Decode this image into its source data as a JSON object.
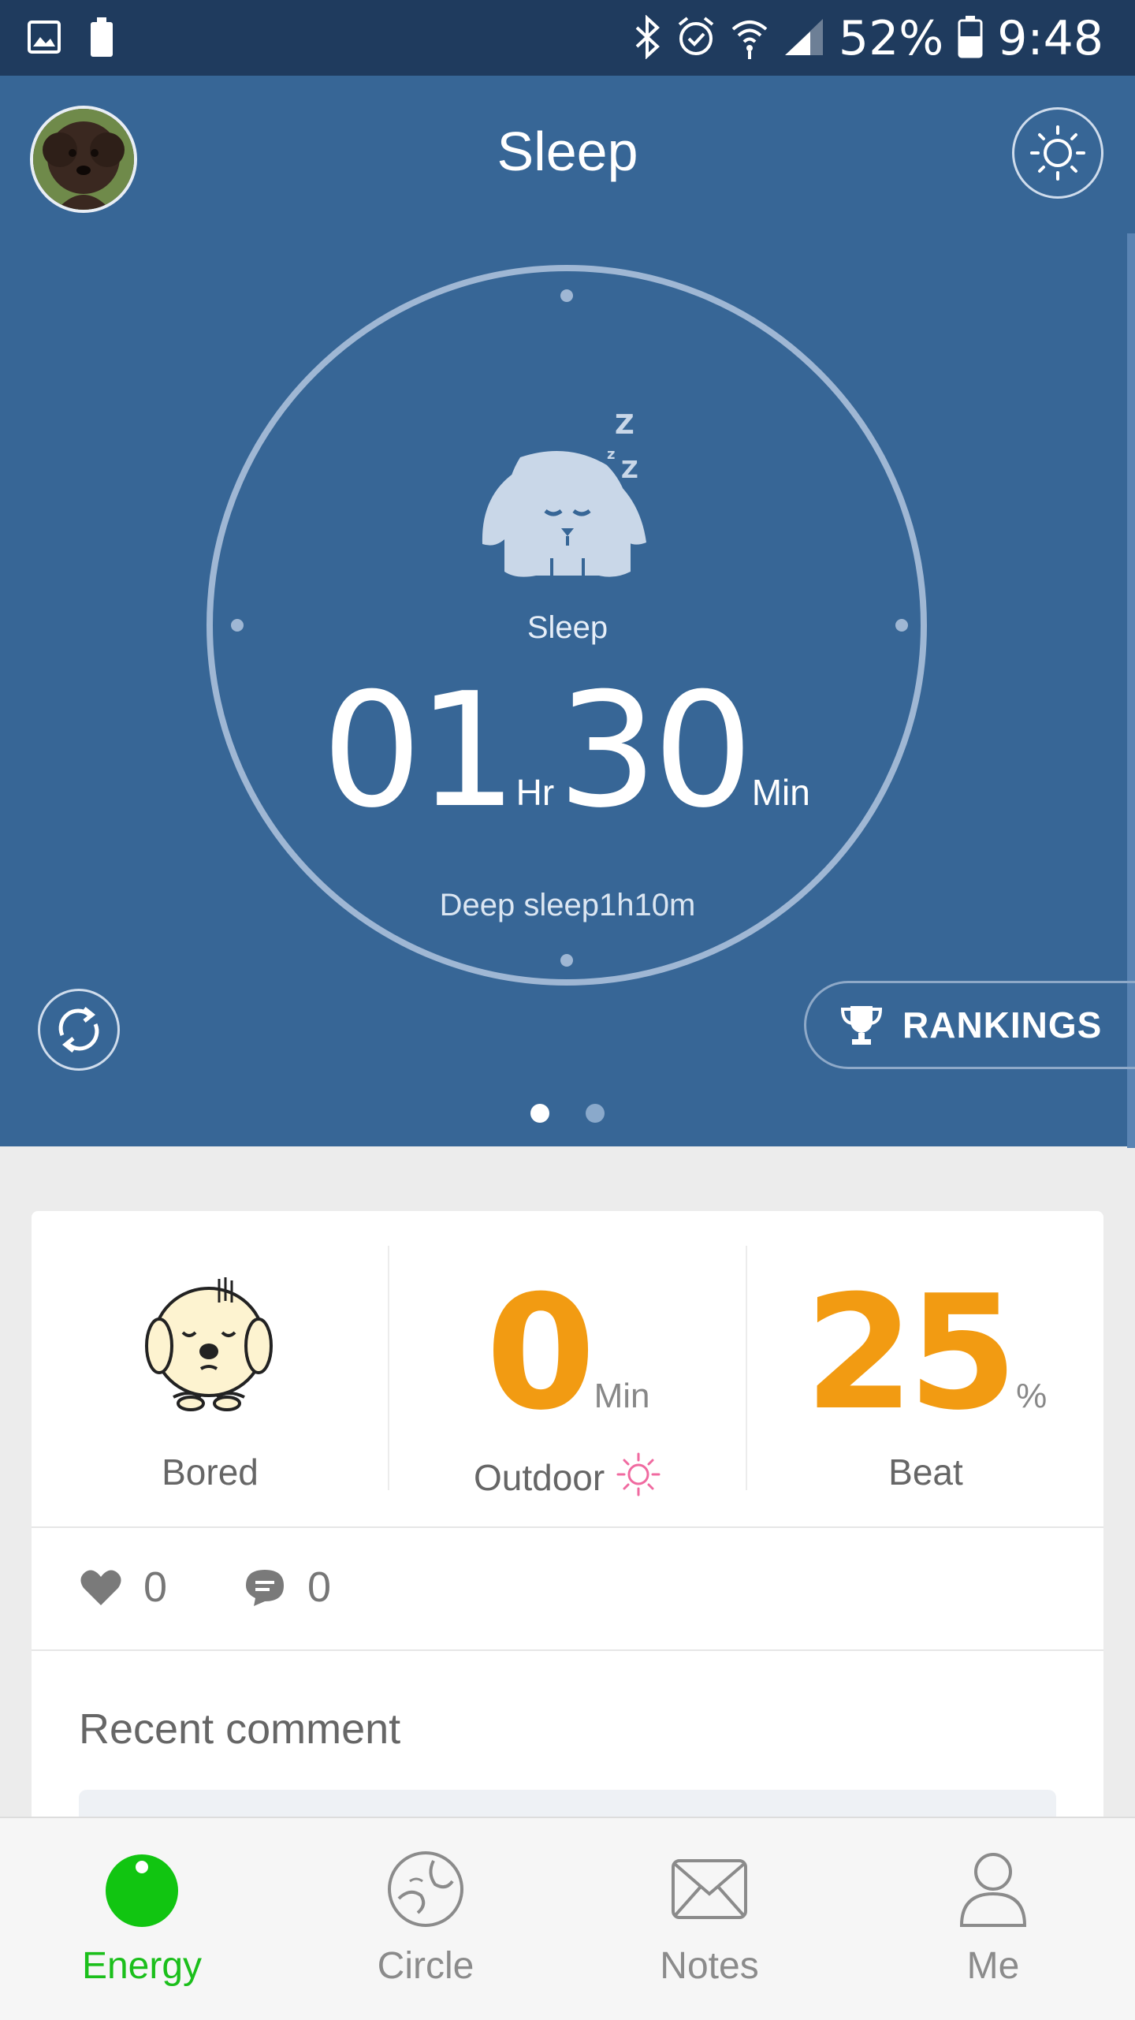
{
  "status_bar": {
    "battery_percent": "52%",
    "time": "9:48",
    "icons": [
      "image-icon",
      "battery-small-icon",
      "bluetooth-icon",
      "alarm-icon",
      "wifi-icon",
      "signal-icon",
      "battery-icon"
    ]
  },
  "header": {
    "title": "Sleep",
    "avatar_icon": "dog-avatar",
    "brightness_icon": "sun-icon"
  },
  "dial": {
    "label": "Sleep",
    "hours": "01",
    "hours_unit": "Hr",
    "minutes": "30",
    "minutes_unit": "Min",
    "deep_sleep": "Deep sleep1h10m",
    "icon": "sleeping-dog-icon"
  },
  "controls": {
    "refresh_icon": "refresh-icon",
    "rankings_label": "RANKINGS",
    "rankings_icon": "trophy-icon",
    "pager_total": 2,
    "pager_active": 1
  },
  "stats": {
    "mood_label": "Bored",
    "mood_icon": "bored-dog-icon",
    "outdoor_value": "0",
    "outdoor_unit": "Min",
    "outdoor_label": "Outdoor",
    "beat_value": "25",
    "beat_unit": "%",
    "beat_label": "Beat"
  },
  "social": {
    "likes": "0",
    "comments": "0"
  },
  "recent_comment_title": "Recent comment",
  "tabs": [
    {
      "label": "Energy",
      "icon": "energy-icon",
      "active": true
    },
    {
      "label": "Circle",
      "icon": "circle-icon",
      "active": false
    },
    {
      "label": "Notes",
      "icon": "envelope-icon",
      "active": false
    },
    {
      "label": "Me",
      "icon": "person-icon",
      "active": false
    }
  ],
  "colors": {
    "header_bg": "#376696",
    "status_bg": "#1f3b5e",
    "accent_orange": "#f29b12",
    "active_tab_green": "#1bbf1b"
  }
}
